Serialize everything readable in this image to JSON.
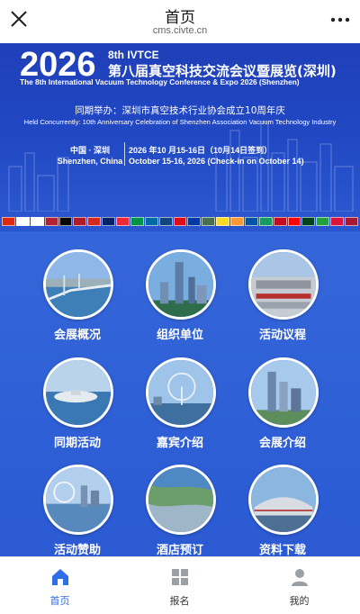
{
  "topbar": {
    "title": "首页",
    "url": "cms.civte.cn",
    "close_icon": "close-icon",
    "more_icon": "more-dots-icon"
  },
  "banner": {
    "year": "2026",
    "edition": "8th IVTCE",
    "title_cn": "第八届真空科技交流会议暨展览(深圳)",
    "title_en": "The 8th International Vacuum Technology Conference & Expo 2026 (Shenzhen)",
    "concurrent_cn": "同期举办：深圳市真空技术行业协会成立10周年庆",
    "concurrent_en": "Held Concurrently: 10th Anniversary Celebration of Shenzhen Association Vacuum Technology Industry",
    "location_cn": "中国 · 深圳",
    "location_en": "Shenzhen, China",
    "dates_cn": "2026 年10 月15-16日（10月14日签到）",
    "dates_en": "October 15-16, 2026 (Check-in on October 14)"
  },
  "flags": [
    {
      "name": "hong-kong-flag",
      "color": "#de2910"
    },
    {
      "name": "korea-flag",
      "color": "#ffffff"
    },
    {
      "name": "japan-flag",
      "color": "#ffffff"
    },
    {
      "name": "usa-flag",
      "color": "#b22234"
    },
    {
      "name": "germany-flag",
      "color": "#000000"
    },
    {
      "name": "netherlands-flag",
      "color": "#ae1c28"
    },
    {
      "name": "switzerland-flag",
      "color": "#d52b1e"
    },
    {
      "name": "uk-flag",
      "color": "#012169"
    },
    {
      "name": "austria-flag",
      "color": "#ed2939"
    },
    {
      "name": "italy-flag",
      "color": "#009246"
    },
    {
      "name": "sweden-flag",
      "color": "#006aa7"
    },
    {
      "name": "czech-flag",
      "color": "#11457e"
    },
    {
      "name": "turkey-flag",
      "color": "#e30a17"
    },
    {
      "name": "russia-flag",
      "color": "#0039a6"
    },
    {
      "name": "hungary-flag",
      "color": "#477050"
    },
    {
      "name": "belgium-flag",
      "color": "#fdda24"
    },
    {
      "name": "india-flag",
      "color": "#ff9933"
    },
    {
      "name": "france-flag",
      "color": "#0055a4"
    },
    {
      "name": "ireland-flag",
      "color": "#169b62"
    },
    {
      "name": "spain-flag",
      "color": "#c60b1e"
    },
    {
      "name": "canada-flag",
      "color": "#ff0000"
    },
    {
      "name": "pakistan-flag",
      "color": "#01411c"
    },
    {
      "name": "iran-flag",
      "color": "#239f40"
    },
    {
      "name": "poland-flag",
      "color": "#dc143c"
    },
    {
      "name": "thailand-flag",
      "color": "#a51931"
    }
  ],
  "grid": {
    "items": [
      {
        "label": "会展概况",
        "icon": "bridge-photo"
      },
      {
        "label": "组织单位",
        "icon": "city-tower-photo"
      },
      {
        "label": "活动议程",
        "icon": "expo-building-photo"
      },
      {
        "label": "同期活动",
        "icon": "harbor-photo"
      },
      {
        "label": "嘉宾介绍",
        "icon": "ferris-wheel-photo"
      },
      {
        "label": "会展介绍",
        "icon": "skyscraper-photo"
      },
      {
        "label": "活动赞助",
        "icon": "ferris-wheel-city-photo"
      },
      {
        "label": "酒店预订",
        "icon": "bay-aerial-photo"
      },
      {
        "label": "资料下载",
        "icon": "convention-hall-photo"
      }
    ]
  },
  "tabbar": {
    "tabs": [
      {
        "label": "首页",
        "icon": "home-icon",
        "active": true
      },
      {
        "label": "报名",
        "icon": "grid-icon",
        "active": false
      },
      {
        "label": "我的",
        "icon": "user-icon",
        "active": false
      }
    ],
    "active_color": "#2e6ee6"
  }
}
